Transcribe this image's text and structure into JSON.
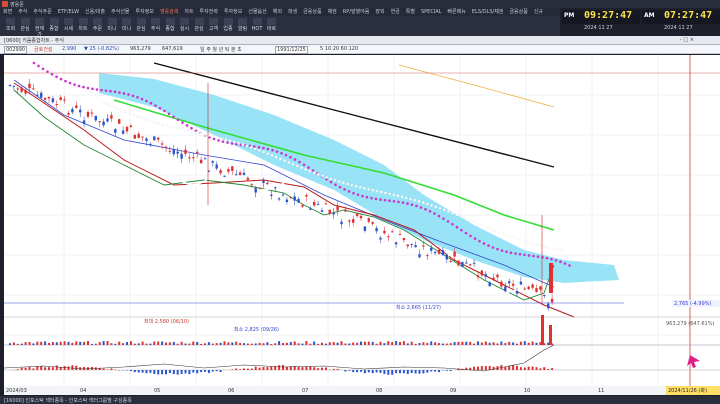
{
  "app": {
    "title": "영웅문"
  },
  "menu": [
    "화면",
    "주식",
    "주식주문",
    "ETF/ELW",
    "신용/대출",
    "주식선물",
    "투자정보",
    "영웅검색",
    "차트",
    "투자전략",
    "투자정보",
    "선물옵션",
    "해외",
    "파생",
    "금융상품",
    "채권",
    "RP/발행어음",
    "장외",
    "연금",
    "특별",
    "SPECIAL",
    "빠른메뉴",
    "ELS/DLS/채권",
    "금융상품",
    "신규"
  ],
  "menu_hi_index": 7,
  "toolbar": [
    "조회",
    "관심",
    "현재가",
    "종합",
    "시세",
    "차트",
    "주문",
    "미니",
    "미니",
    "관심",
    "주식",
    "종합",
    "실시",
    "관심",
    "고객",
    "업종",
    "알림",
    "HOT",
    "바로"
  ],
  "clocks": [
    {
      "label": "PM",
      "time": "09:27:47",
      "date": "2024 11 27"
    },
    {
      "label": "AM",
      "time": "07:27:47",
      "date": "2024 11 27"
    }
  ],
  "window": {
    "title": "[0600] 키움종합차트 - 주식",
    "code_input": "002990",
    "name_label": "금호건설",
    "controls": "- □ ×"
  },
  "infobar": {
    "code_label": "[0600] 키움종합차트 - KOSPI 외국인보유 [KRX] 주식수 [36,954(전)] 액면가[5,000] 자본금[1,840억] 결산[12월] EPS[30] PER[105.04] 시가총액[1,105억] 유통비율[49.4]",
    "price": "2,990",
    "change": "▼ 25 (-0.82%)",
    "volume": "963,279",
    "amount": "647,619",
    "dates": "1991/12/25",
    "period": "일 주 월 년 틱 분 초",
    "ma": "5 10 20 60 120"
  },
  "chart": {
    "ma_text": "이동평균 5 10 20 60 120",
    "high_label": "최대 2,580 (06/10)",
    "low_label": "최소 2,665 (11/27)",
    "low2_label": "최소 2,825 (09/26)",
    "price_tag": "2,765 (-4.99%)",
    "vol_tag": "963,279 (647.61%)",
    "dates": [
      "2024/03",
      "04",
      "05",
      "06",
      "07",
      "08",
      "09",
      "10",
      "11"
    ],
    "current_date": "2024/11/26 (화)"
  },
  "status": {
    "text": "[16000] 인포스탁 섹터종목 - 인포스탁 섹터그룹별 구성종목"
  }
}
